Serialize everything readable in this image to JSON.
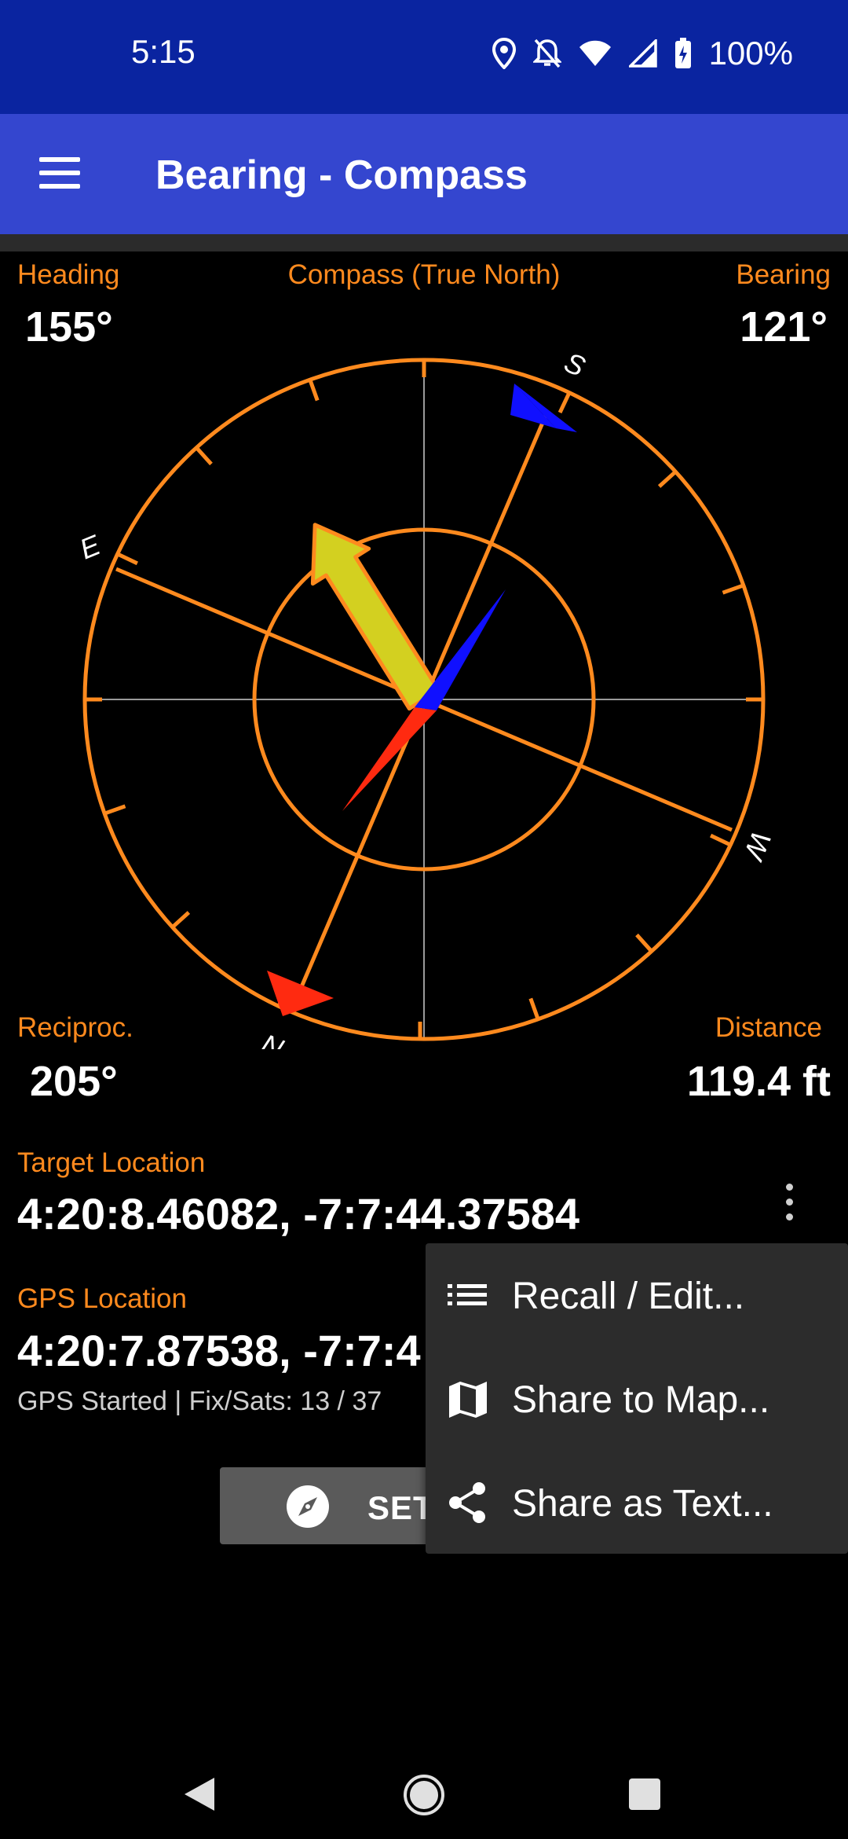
{
  "status_bar": {
    "time": "5:15",
    "battery": "100%"
  },
  "app_bar": {
    "title": "Bearing - Compass"
  },
  "readouts": {
    "heading_label": "Heading",
    "heading_value": "155°",
    "compass_mode": "Compass (True North)",
    "bearing_label": "Bearing",
    "bearing_value": "121°",
    "reciprocal_label": "Reciproc.",
    "reciprocal_value": "205°",
    "distance_label": "Distance",
    "distance_value": "119.4 ft"
  },
  "compass": {
    "cardinals": {
      "n": "N",
      "e": "E",
      "s": "S",
      "w": "W"
    },
    "colors": {
      "ring": "#ff8a1e",
      "heading_arrow": "#d3d020",
      "needle_north": "#ff2a10",
      "needle_south": "#1010ff"
    }
  },
  "target": {
    "label": "Target Location",
    "value": "4:20:8.46082, -7:7:44.37584"
  },
  "gps": {
    "label": "GPS Location",
    "value": "4:20:7.87538, -7:7:4",
    "status": "GPS Started | Fix/Sats: 13 / 37"
  },
  "set_button": {
    "label": "SET",
    "icon": "compass-icon"
  },
  "popup_menu": {
    "items": [
      {
        "label": "Recall / Edit...",
        "icon": "list-icon"
      },
      {
        "label": "Share to Map...",
        "icon": "map-icon"
      },
      {
        "label": "Share as Text...",
        "icon": "share-icon"
      }
    ]
  }
}
